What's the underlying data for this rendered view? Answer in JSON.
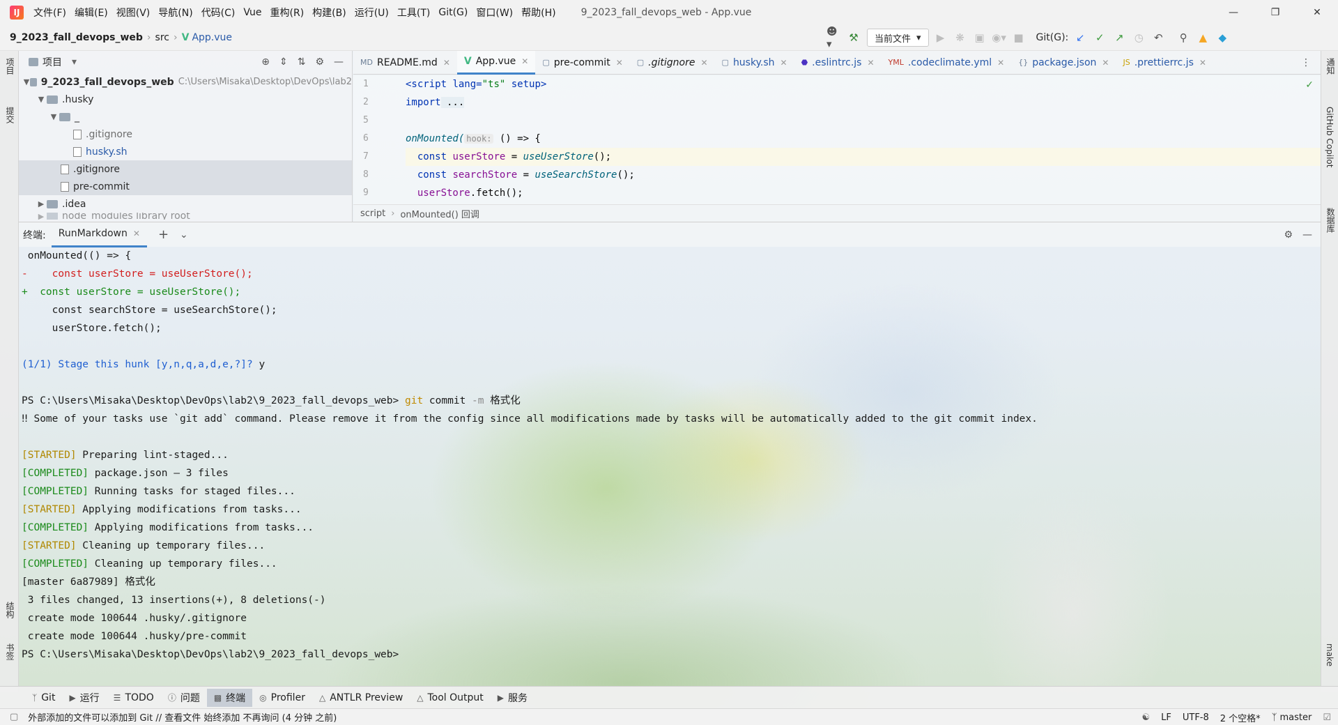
{
  "menubar": {
    "items": [
      "文件(F)",
      "编辑(E)",
      "视图(V)",
      "导航(N)",
      "代码(C)",
      "Vue",
      "重构(R)",
      "构建(B)",
      "运行(U)",
      "工具(T)",
      "Git(G)",
      "窗口(W)",
      "帮助(H)"
    ],
    "window_title": "9_2023_fall_devops_web - App.vue"
  },
  "navbar": {
    "project": "9_2023_fall_devops_web",
    "folder": "src",
    "file": "App.vue",
    "run_config": "当前文件",
    "git_label": "Git(G):"
  },
  "left_strip": {
    "top": "项目",
    "commit": "提交",
    "structure": "结构",
    "bookmarks": "书签"
  },
  "right_strip": {
    "notifications": "通知",
    "copilot": "GitHub Copilot",
    "database": "数据库",
    "make": "make"
  },
  "project_panel": {
    "title": "项目",
    "root_name": "9_2023_fall_devops_web",
    "root_path": "C:\\Users\\Misaka\\Desktop\\DevOps\\lab2",
    "nodes": [
      ".husky",
      "_",
      ".gitignore",
      "husky.sh",
      ".gitignore",
      "pre-commit",
      ".idea",
      "node_modules library root"
    ]
  },
  "editor": {
    "tabs": [
      {
        "label": "README.md",
        "icon": "markdown-icon"
      },
      {
        "label": "App.vue",
        "icon": "vue-icon"
      },
      {
        "label": "pre-commit",
        "icon": "file-icon"
      },
      {
        "label": ".gitignore",
        "icon": "gitignore-icon"
      },
      {
        "label": "husky.sh",
        "icon": "shell-icon"
      },
      {
        "label": ".eslintrc.js",
        "icon": "eslint-icon"
      },
      {
        "label": ".codeclimate.yml",
        "icon": "yaml-icon"
      },
      {
        "label": "package.json",
        "icon": "json-icon"
      },
      {
        "label": ".prettierrc.js",
        "icon": "js-icon"
      }
    ],
    "line_numbers": [
      "1",
      "2",
      "5",
      "6",
      "7",
      "8",
      "9"
    ],
    "code": {
      "l1_tag": "<script",
      "l1_attr": " lang=",
      "l1_val": "\"ts\"",
      "l1_attr2": " setup",
      "l1_end": ">",
      "l2_kw": "import",
      "l2_rest": " ...",
      "l6_fn": "onMounted(",
      "l6_hint": "hook:",
      "l6_rest": " () => {",
      "l7_kw": "const",
      "l7_var": "userStore",
      "l7_eq": " = ",
      "l7_call": "useUserStore",
      "l7_end": "();",
      "l8_kw": "const",
      "l8_var": "searchStore",
      "l8_eq": " = ",
      "l8_call": "useSearchStore",
      "l8_end": "();",
      "l9_obj": "userStore",
      "l9_rest": ".fetch();"
    },
    "breadcrumb": [
      "script",
      "onMounted() 回调"
    ]
  },
  "terminal": {
    "label": "终端:",
    "tab": "RunMarkdown",
    "lines": {
      "l1": " onMounted(() => {",
      "l2": "-    const userStore = useUserStore();",
      "l3": "+  const userStore = useUserStore();",
      "l4": "     const searchStore = useSearchStore();",
      "l5": "     userStore.fetch();",
      "l6a": "(1/1) Stage this hunk [y,n,q,a,d,e,?]?",
      "l6b": " y",
      "l7_prompt": "PS C:\\Users\\Misaka\\Desktop\\DevOps\\lab2\\9_2023_fall_devops_web> ",
      "l7_git": "git",
      "l7_cmd": " commit ",
      "l7_flag": "-m",
      "l7_msg": " 格式化",
      "l8": "‼ Some of your tasks use `git add` command. Please remove it from the config since all modifications made by tasks will be automatically added to the git commit index.",
      "s1_tag": "[STARTED]",
      "s1": " Preparing lint-staged...",
      "s2_tag": "[COMPLETED]",
      "s2": " package.json — 3 files",
      "s3_tag": "[COMPLETED]",
      "s3": " Running tasks for staged files...",
      "s4_tag": "[STARTED]",
      "s4": " Applying modifications from tasks...",
      "s5_tag": "[COMPLETED]",
      "s5": " Applying modifications from tasks...",
      "s6_tag": "[STARTED]",
      "s6": " Cleaning up temporary files...",
      "s7_tag": "[COMPLETED]",
      "s7": " Cleaning up temporary files...",
      "r1": "[master 6a87989] 格式化",
      "r2": " 3 files changed, 13 insertions(+), 8 deletions(-)",
      "r3": " create mode 100644 .husky/.gitignore",
      "r4": " create mode 100644 .husky/pre-commit",
      "r5": "PS C:\\Users\\Misaka\\Desktop\\DevOps\\lab2\\9_2023_fall_devops_web>"
    }
  },
  "bottom_tools": [
    "Git",
    "运行",
    "TODO",
    "问题",
    "终端",
    "Profiler",
    "ANTLR Preview",
    "Tool Output",
    "服务"
  ],
  "status": {
    "message": "外部添加的文件可以添加到 Git // 查看文件   始终添加   不再询问 (4 分钟 之前)",
    "line_sep": "LF",
    "encoding": "UTF-8",
    "indent": "2 个空格*",
    "branch": "master"
  }
}
